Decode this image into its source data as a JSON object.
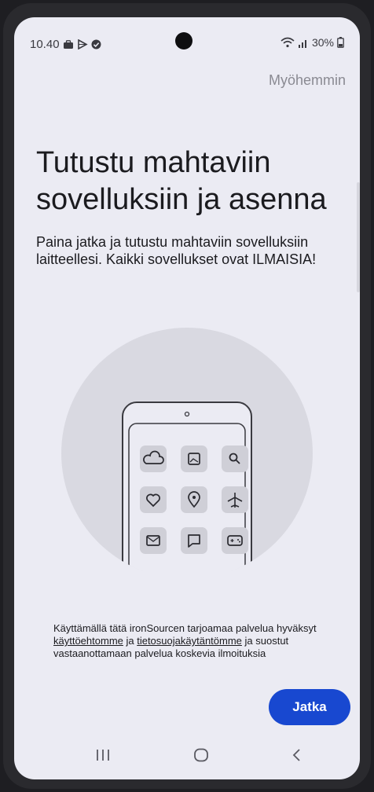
{
  "status": {
    "time": "10.40",
    "battery": "30%",
    "left_icons": [
      "briefcase-icon",
      "play-icon",
      "check-circle-icon"
    ],
    "right_icons": [
      "wifi-icon",
      "signal-icon",
      "battery-icon"
    ]
  },
  "header": {
    "later_label": "Myöhemmin"
  },
  "main": {
    "title": "Tutustu mahtaviin sovelluksiin ja asenna",
    "description": "Paina jatka ja tutustu mahtaviin sovelluksiin laitteellesi. Kaikki sovellukset ovat ILMAISIA!"
  },
  "illustration": {
    "icons": [
      "cloud-icon",
      "image-icon",
      "search-icon",
      "heart-icon",
      "location-pin-icon",
      "airplane-icon",
      "mail-icon",
      "chat-icon",
      "gamepad-icon"
    ]
  },
  "legal": {
    "text_before": "Käyttämällä tätä ironSourcen tarjoamaa palvelua hyväksyt ",
    "terms_link": "käyttöehtomme",
    "middle": " ja ",
    "privacy_link": "tietosuojakäytäntömme",
    "text_after": " ja suostut vastaanottamaan palvelua koskevia ilmoituksia"
  },
  "footer": {
    "continue_label": "Jatka"
  },
  "navbar": {
    "buttons": [
      "recents-icon",
      "home-icon",
      "back-icon"
    ]
  },
  "colors": {
    "accent": "#1848d0",
    "background": "#ebebf3",
    "text": "#1b1b1f"
  }
}
